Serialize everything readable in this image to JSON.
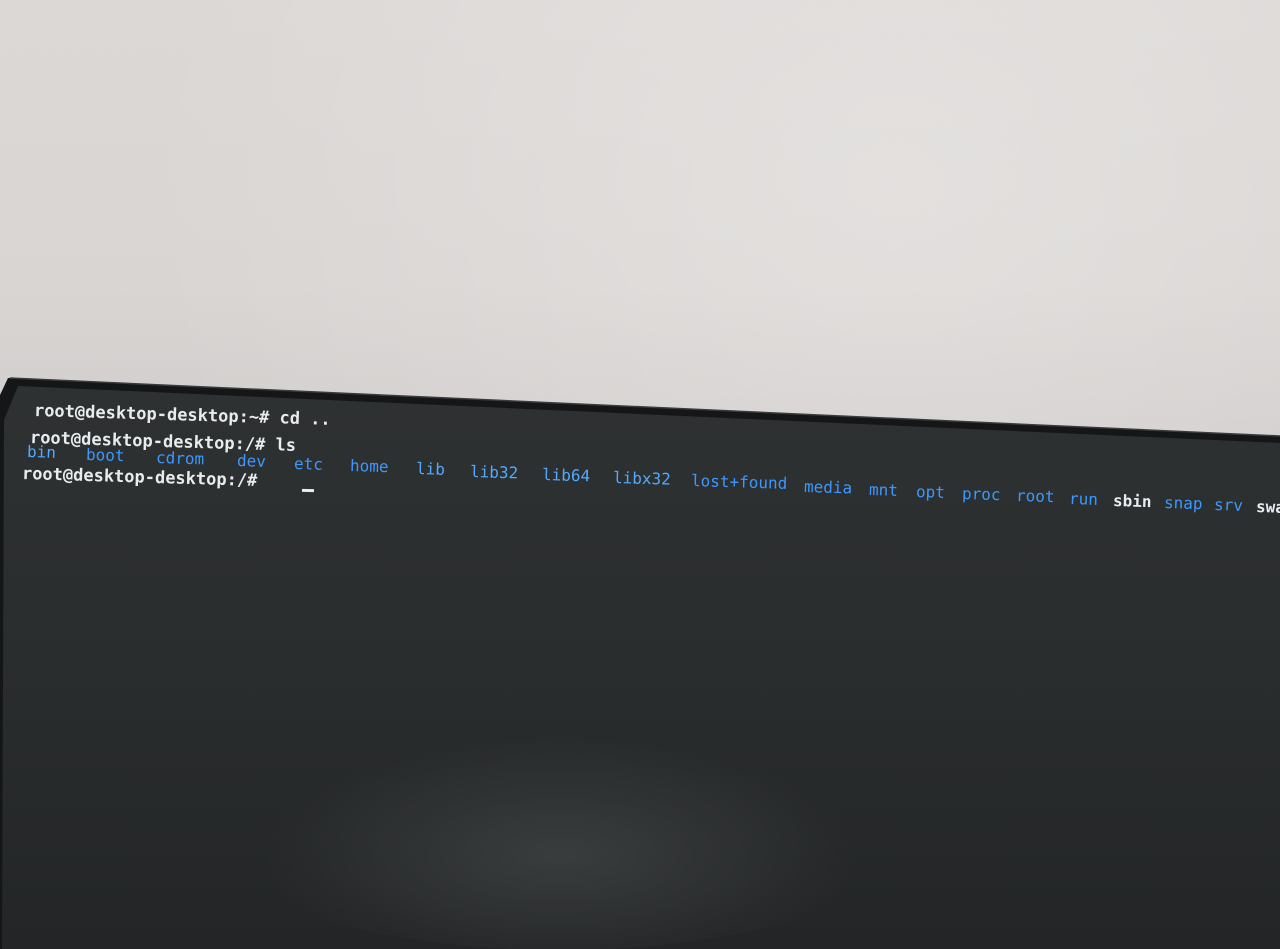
{
  "terminal": {
    "lines": {
      "cd_command": "root@desktop-desktop:~# cd ..",
      "ls_command": "root@desktop-desktop:/# ls",
      "prompt": "root@desktop-desktop:/# "
    },
    "ls_output": [
      {
        "name": "bin",
        "style": "link"
      },
      {
        "name": "boot",
        "style": "dir"
      },
      {
        "name": "cdrom",
        "style": "dir"
      },
      {
        "name": "dev",
        "style": "dir"
      },
      {
        "name": "etc",
        "style": "dir"
      },
      {
        "name": "home",
        "style": "dir"
      },
      {
        "name": "lib",
        "style": "link"
      },
      {
        "name": "lib32",
        "style": "link"
      },
      {
        "name": "lib64",
        "style": "link"
      },
      {
        "name": "libx32",
        "style": "link"
      },
      {
        "name": "lost+found",
        "style": "dir"
      },
      {
        "name": "media",
        "style": "dir"
      },
      {
        "name": "mnt",
        "style": "dir"
      },
      {
        "name": "opt",
        "style": "dir"
      },
      {
        "name": "proc",
        "style": "dir"
      },
      {
        "name": "root",
        "style": "dir"
      },
      {
        "name": "run",
        "style": "dir"
      },
      {
        "name": "sbin",
        "style": "file"
      },
      {
        "name": "snap",
        "style": "dir"
      },
      {
        "name": "srv",
        "style": "dir"
      },
      {
        "name": "swa",
        "style": "file"
      }
    ]
  },
  "colors": {
    "wall": "#d9d5d3",
    "screen": "#2c2f30",
    "bezel": "#151617",
    "text": "#e9ecef",
    "directory": "#3c98ff",
    "link": "#7fd2ff"
  }
}
